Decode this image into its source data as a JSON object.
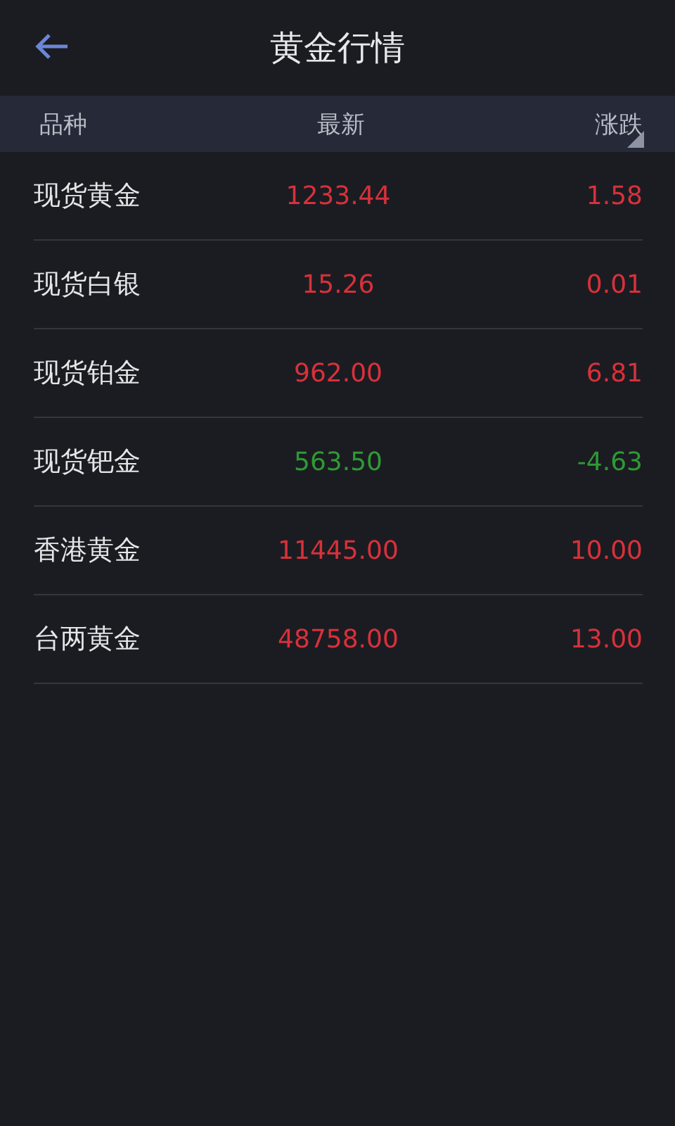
{
  "header": {
    "title": "黄金行情"
  },
  "table": {
    "columns": [
      "品种",
      "最新",
      "涨跌"
    ],
    "rows": [
      {
        "name": "现货黄金",
        "latest": "1233.44",
        "change": "1.58",
        "color": "#d8313a"
      },
      {
        "name": "现货白银",
        "latest": "15.26",
        "change": "0.01",
        "color": "#d8313a"
      },
      {
        "name": "现货铂金",
        "latest": "962.00",
        "change": "6.81",
        "color": "#d8313a"
      },
      {
        "name": "现货钯金",
        "latest": "563.50",
        "change": "-4.63",
        "color": "#2e9a34"
      },
      {
        "name": "香港黄金",
        "latest": "11445.00",
        "change": "10.00",
        "color": "#d8313a"
      },
      {
        "name": "台两黄金",
        "latest": "48758.00",
        "change": "13.00",
        "color": "#d8313a"
      }
    ]
  }
}
